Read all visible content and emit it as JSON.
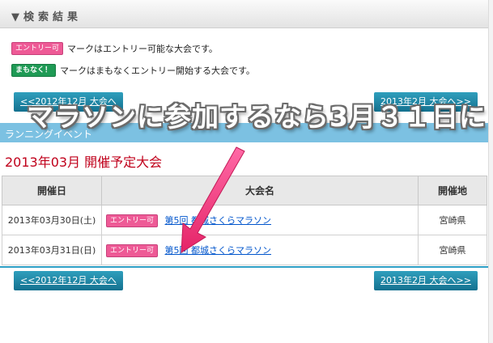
{
  "header": {
    "title": "▼検索結果"
  },
  "legend": {
    "entry_badge": "エントリー可",
    "entry_text": "マークはエントリー可能な大会です。",
    "soon_badge": "まもなく！",
    "soon_text": "マークはまもなくエントリー開始する大会です。"
  },
  "nav": {
    "prev": "<<2012年12月 大会へ",
    "next": "2013年2月 大会へ>>"
  },
  "overlay": {
    "text": "マラソンに参加するなら3月３１日に"
  },
  "category": {
    "label": "ランニングイベント"
  },
  "month_title": "2013年03月 開催予定大会",
  "table": {
    "headers": {
      "date": "開催日",
      "name": "大会名",
      "place": "開催地"
    },
    "rows": [
      {
        "date": "2013年03月30日(土)",
        "badge": "エントリー可",
        "name": "第5回 都城さくらマラソン",
        "place": "宮崎県"
      },
      {
        "date": "2013年03月31日(日)",
        "badge": "エントリー可",
        "name": "第5回 都城さくらマラソン",
        "place": "宮崎県"
      }
    ]
  },
  "colors": {
    "accent": "#1a7fa3",
    "entry_badge": "#ee5a96",
    "soon_badge": "#1f9a55",
    "month_title": "#c0001b",
    "arrow": "#f0407e"
  }
}
